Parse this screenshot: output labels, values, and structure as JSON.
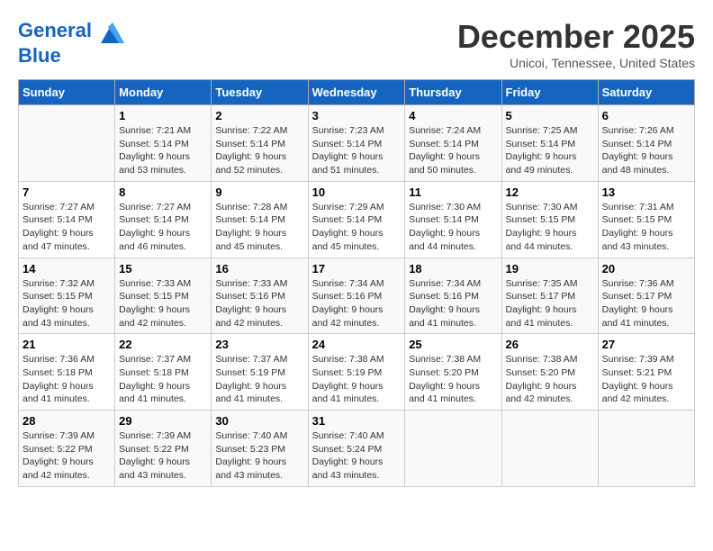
{
  "header": {
    "logo_line1": "General",
    "logo_line2": "Blue",
    "month": "December 2025",
    "location": "Unicoi, Tennessee, United States"
  },
  "days_of_week": [
    "Sunday",
    "Monday",
    "Tuesday",
    "Wednesday",
    "Thursday",
    "Friday",
    "Saturday"
  ],
  "weeks": [
    [
      {
        "day": "",
        "info": ""
      },
      {
        "day": "1",
        "info": "Sunrise: 7:21 AM\nSunset: 5:14 PM\nDaylight: 9 hours\nand 53 minutes."
      },
      {
        "day": "2",
        "info": "Sunrise: 7:22 AM\nSunset: 5:14 PM\nDaylight: 9 hours\nand 52 minutes."
      },
      {
        "day": "3",
        "info": "Sunrise: 7:23 AM\nSunset: 5:14 PM\nDaylight: 9 hours\nand 51 minutes."
      },
      {
        "day": "4",
        "info": "Sunrise: 7:24 AM\nSunset: 5:14 PM\nDaylight: 9 hours\nand 50 minutes."
      },
      {
        "day": "5",
        "info": "Sunrise: 7:25 AM\nSunset: 5:14 PM\nDaylight: 9 hours\nand 49 minutes."
      },
      {
        "day": "6",
        "info": "Sunrise: 7:26 AM\nSunset: 5:14 PM\nDaylight: 9 hours\nand 48 minutes."
      }
    ],
    [
      {
        "day": "7",
        "info": "Sunrise: 7:27 AM\nSunset: 5:14 PM\nDaylight: 9 hours\nand 47 minutes."
      },
      {
        "day": "8",
        "info": "Sunrise: 7:27 AM\nSunset: 5:14 PM\nDaylight: 9 hours\nand 46 minutes."
      },
      {
        "day": "9",
        "info": "Sunrise: 7:28 AM\nSunset: 5:14 PM\nDaylight: 9 hours\nand 45 minutes."
      },
      {
        "day": "10",
        "info": "Sunrise: 7:29 AM\nSunset: 5:14 PM\nDaylight: 9 hours\nand 45 minutes."
      },
      {
        "day": "11",
        "info": "Sunrise: 7:30 AM\nSunset: 5:14 PM\nDaylight: 9 hours\nand 44 minutes."
      },
      {
        "day": "12",
        "info": "Sunrise: 7:30 AM\nSunset: 5:15 PM\nDaylight: 9 hours\nand 44 minutes."
      },
      {
        "day": "13",
        "info": "Sunrise: 7:31 AM\nSunset: 5:15 PM\nDaylight: 9 hours\nand 43 minutes."
      }
    ],
    [
      {
        "day": "14",
        "info": "Sunrise: 7:32 AM\nSunset: 5:15 PM\nDaylight: 9 hours\nand 43 minutes."
      },
      {
        "day": "15",
        "info": "Sunrise: 7:33 AM\nSunset: 5:15 PM\nDaylight: 9 hours\nand 42 minutes."
      },
      {
        "day": "16",
        "info": "Sunrise: 7:33 AM\nSunset: 5:16 PM\nDaylight: 9 hours\nand 42 minutes."
      },
      {
        "day": "17",
        "info": "Sunrise: 7:34 AM\nSunset: 5:16 PM\nDaylight: 9 hours\nand 42 minutes."
      },
      {
        "day": "18",
        "info": "Sunrise: 7:34 AM\nSunset: 5:16 PM\nDaylight: 9 hours\nand 41 minutes."
      },
      {
        "day": "19",
        "info": "Sunrise: 7:35 AM\nSunset: 5:17 PM\nDaylight: 9 hours\nand 41 minutes."
      },
      {
        "day": "20",
        "info": "Sunrise: 7:36 AM\nSunset: 5:17 PM\nDaylight: 9 hours\nand 41 minutes."
      }
    ],
    [
      {
        "day": "21",
        "info": "Sunrise: 7:36 AM\nSunset: 5:18 PM\nDaylight: 9 hours\nand 41 minutes."
      },
      {
        "day": "22",
        "info": "Sunrise: 7:37 AM\nSunset: 5:18 PM\nDaylight: 9 hours\nand 41 minutes."
      },
      {
        "day": "23",
        "info": "Sunrise: 7:37 AM\nSunset: 5:19 PM\nDaylight: 9 hours\nand 41 minutes."
      },
      {
        "day": "24",
        "info": "Sunrise: 7:38 AM\nSunset: 5:19 PM\nDaylight: 9 hours\nand 41 minutes."
      },
      {
        "day": "25",
        "info": "Sunrise: 7:38 AM\nSunset: 5:20 PM\nDaylight: 9 hours\nand 41 minutes."
      },
      {
        "day": "26",
        "info": "Sunrise: 7:38 AM\nSunset: 5:20 PM\nDaylight: 9 hours\nand 42 minutes."
      },
      {
        "day": "27",
        "info": "Sunrise: 7:39 AM\nSunset: 5:21 PM\nDaylight: 9 hours\nand 42 minutes."
      }
    ],
    [
      {
        "day": "28",
        "info": "Sunrise: 7:39 AM\nSunset: 5:22 PM\nDaylight: 9 hours\nand 42 minutes."
      },
      {
        "day": "29",
        "info": "Sunrise: 7:39 AM\nSunset: 5:22 PM\nDaylight: 9 hours\nand 43 minutes."
      },
      {
        "day": "30",
        "info": "Sunrise: 7:40 AM\nSunset: 5:23 PM\nDaylight: 9 hours\nand 43 minutes."
      },
      {
        "day": "31",
        "info": "Sunrise: 7:40 AM\nSunset: 5:24 PM\nDaylight: 9 hours\nand 43 minutes."
      },
      {
        "day": "",
        "info": ""
      },
      {
        "day": "",
        "info": ""
      },
      {
        "day": "",
        "info": ""
      }
    ]
  ]
}
